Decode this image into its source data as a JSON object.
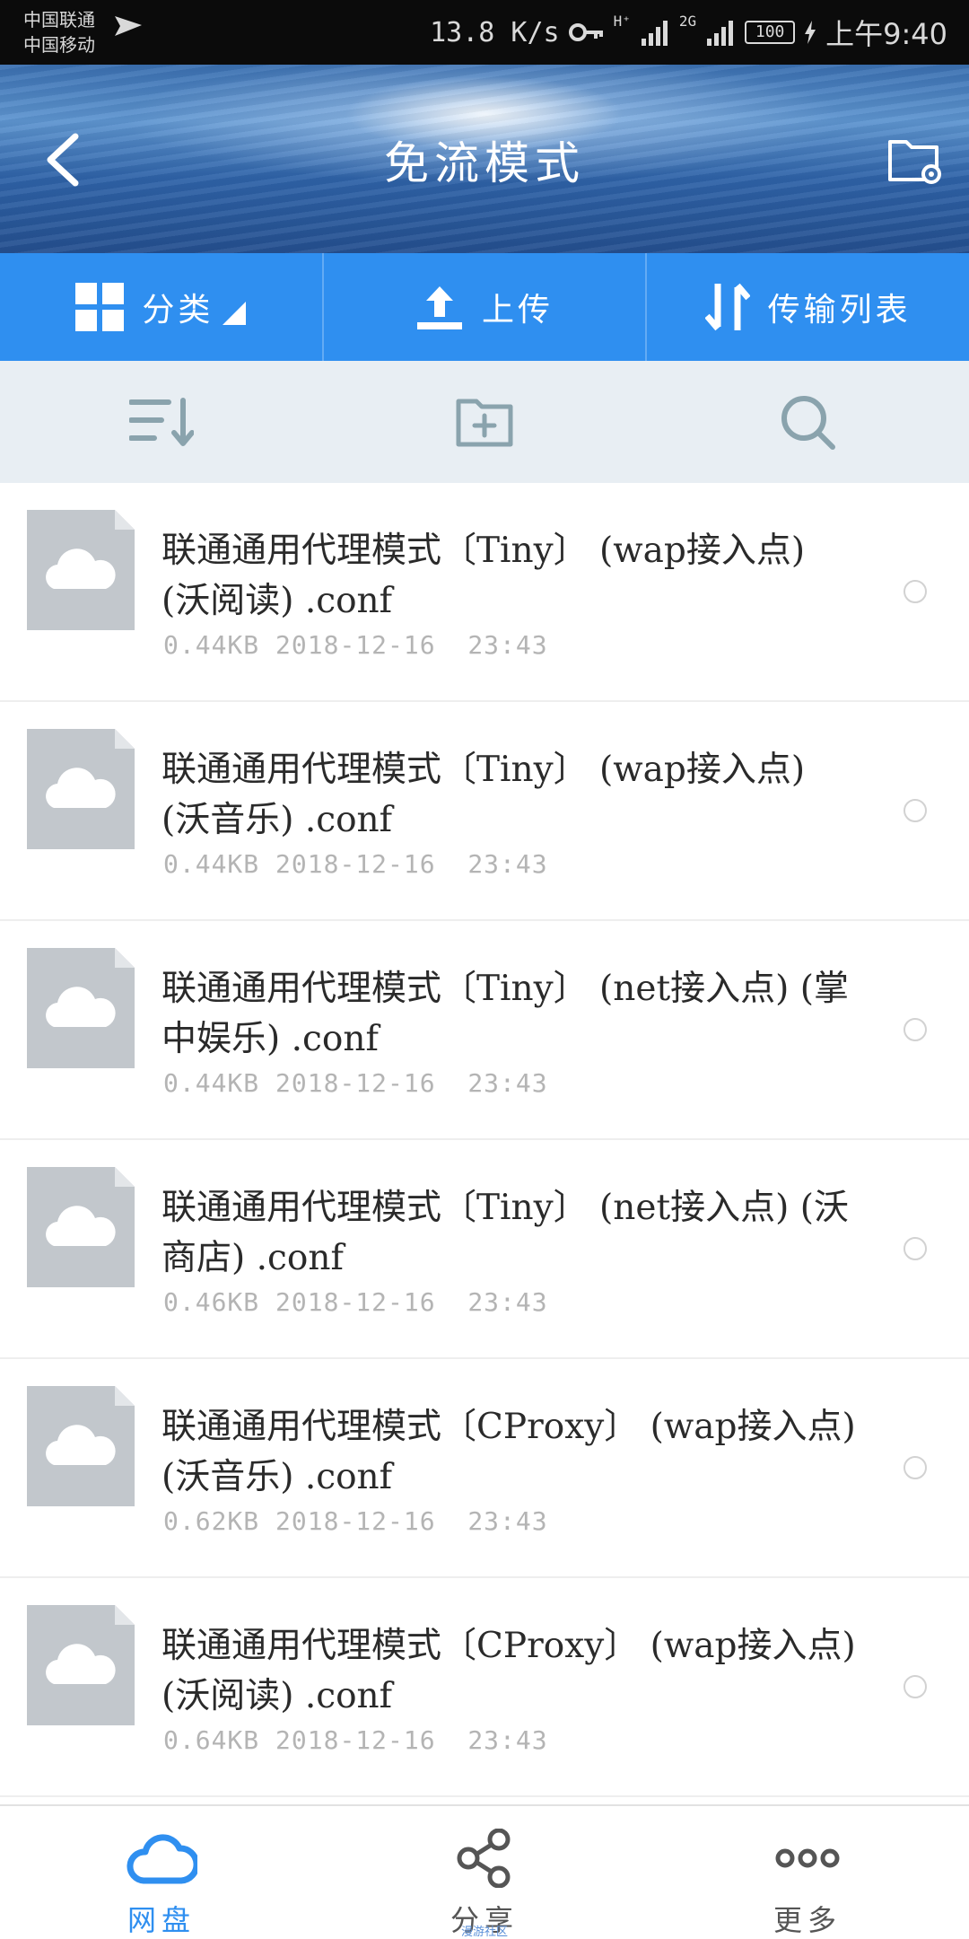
{
  "status_bar": {
    "carrier_1": "中国联通",
    "carrier_2": "中国移动",
    "speed": "13.8 K/s",
    "network_1": "H⁺",
    "network_2": "2G",
    "battery": "100",
    "time": "上午9:40"
  },
  "header": {
    "title": "免流模式"
  },
  "action_bar": {
    "category_label": "分类",
    "upload_label": "上传",
    "transfer_label": "传输列表"
  },
  "files": [
    {
      "name": "联通通用代理模式〔Tiny〕 (wap接入点) (沃阅读) .conf",
      "size": "0.44KB",
      "date": "2018-12-16",
      "time": "23:43"
    },
    {
      "name": "联通通用代理模式〔Tiny〕 (wap接入点) (沃音乐) .conf",
      "size": "0.44KB",
      "date": "2018-12-16",
      "time": "23:43"
    },
    {
      "name": "联通通用代理模式〔Tiny〕 (net接入点) (掌中娱乐) .conf",
      "size": "0.44KB",
      "date": "2018-12-16",
      "time": "23:43"
    },
    {
      "name": "联通通用代理模式〔Tiny〕 (net接入点) (沃商店) .conf",
      "size": "0.46KB",
      "date": "2018-12-16",
      "time": "23:43"
    },
    {
      "name": "联通通用代理模式〔CProxy〕 (wap接入点) (沃音乐) .conf",
      "size": "0.62KB",
      "date": "2018-12-16",
      "time": "23:43"
    },
    {
      "name": "联通通用代理模式〔CProxy〕 (wap接入点) (沃阅读) .conf",
      "size": "0.64KB",
      "date": "2018-12-16",
      "time": "23:43"
    }
  ],
  "bottom_nav": {
    "disk_label": "网盘",
    "share_label": "分享",
    "more_label": "更多",
    "watermark": "漫游社区"
  },
  "colors": {
    "primary": "#2f8ff0",
    "toolbar_bg": "#e8eef3",
    "icon_gray": "#8aa3ad",
    "thumb_gray": "#c2c7cc"
  }
}
